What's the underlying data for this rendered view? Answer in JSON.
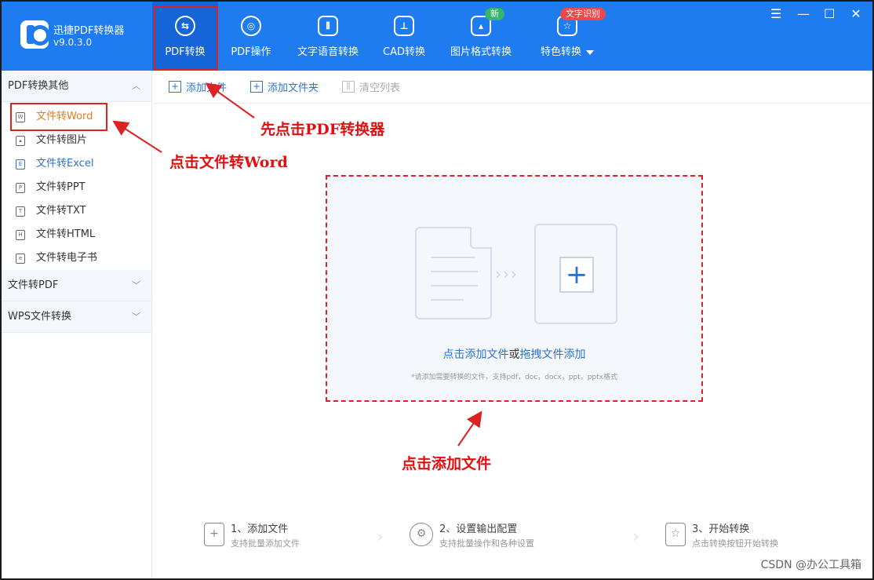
{
  "app": {
    "name": "迅捷PDF转换器",
    "version": "v9.0.3.0"
  },
  "nav": [
    {
      "label": "PDF转换",
      "icon": "pdf-convert-icon",
      "active": true
    },
    {
      "label": "PDF操作",
      "icon": "pdf-operate-icon"
    },
    {
      "label": "文字语音转换",
      "icon": "voice-wave-icon"
    },
    {
      "label": "CAD转换",
      "icon": "cad-icon"
    },
    {
      "label": "图片格式转换",
      "icon": "image-icon",
      "badge": "新"
    },
    {
      "label": "特色转换",
      "icon": "star-box-icon",
      "badge": "文字识别"
    }
  ],
  "window_controls": {
    "menu": "☰",
    "minimize": "—",
    "maximize": "☐",
    "close": "✕"
  },
  "sidebar": {
    "groups": [
      {
        "title": "PDF转换其他",
        "items": [
          "文件转Word",
          "文件转图片",
          "文件转Excel",
          "文件转PPT",
          "文件转TXT",
          "文件转HTML",
          "文件转电子书"
        ]
      },
      {
        "title": "文件转PDF"
      },
      {
        "title": "WPS文件转换"
      }
    ]
  },
  "toolbar": {
    "add_file": "添加文件",
    "add_folder": "添加文件夹",
    "clear_list": "清空列表"
  },
  "dropzone": {
    "link1": "点击添加文件",
    "or": "或",
    "link2": "拖拽文件添加",
    "hint": "*请添加需要转换的文件，支持pdf，doc，docx，ppt，pptx格式"
  },
  "steps": [
    {
      "title": "1、添加文件",
      "sub": "支持批量添加文件"
    },
    {
      "title": "2、设置输出配置",
      "sub": "支持批量操作和各种设置"
    },
    {
      "title": "3、开始转换",
      "sub": "点击转换按钮开始转换"
    }
  ],
  "annotations": {
    "click_converter": "先点击PDF转换器",
    "click_word": "点击文件转Word",
    "click_add": "点击添加文件"
  },
  "watermark": "CSDN @办公工具箱",
  "colors": {
    "brand_blue": "#1e7bf0",
    "active_blue": "#1565d8",
    "annotation_red": "#dd2222",
    "orange": "#e57c1f"
  }
}
